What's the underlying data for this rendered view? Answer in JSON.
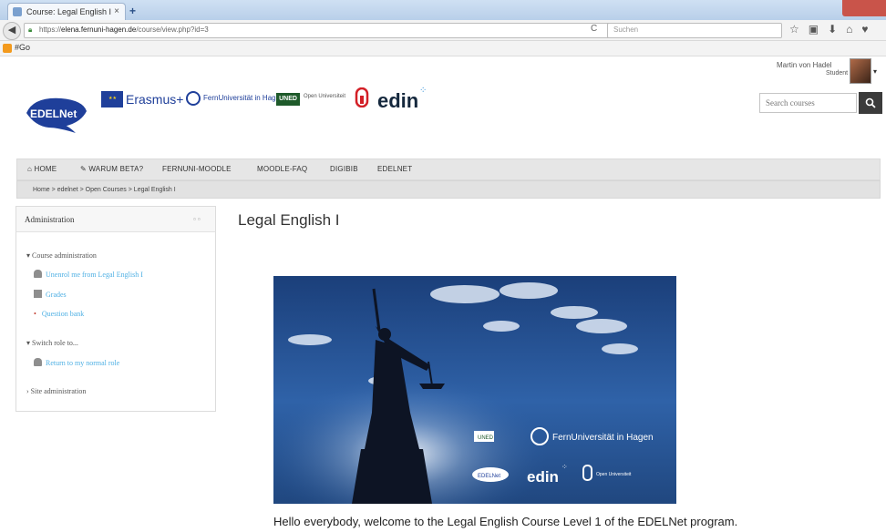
{
  "browser": {
    "tab_title": "Course: Legal English I",
    "url_prefix": "https://",
    "url_host": "elena.fernuni-hagen.de",
    "url_path": "/course/view.php?id=3",
    "search_placeholder": "Suchen",
    "bookmark_label": "Go"
  },
  "user": {
    "name": "Martin von Hadel",
    "role": "Student"
  },
  "logos": {
    "edelnet": "EDELNet",
    "erasmus": "Erasmus+",
    "fernuni": "FernUniversität in Hagen",
    "uned": "UNED",
    "open_univ": "Open Universiteit",
    "edin": "edin"
  },
  "search": {
    "placeholder": "Search courses"
  },
  "nav": {
    "home": "HOME",
    "beta": "WARUM BETA?",
    "fernuni_moodle": "FERNUNI-MOODLE",
    "moodle_faq": "MOODLE-FAQ",
    "digibib": "DIGIBIB",
    "edelnet": "EDELNET"
  },
  "breadcrumb": {
    "home": "Home",
    "sep": ">",
    "edelnet": "edelnet",
    "open_courses": "Open Courses",
    "course": "Legal English I"
  },
  "admin": {
    "title": "Administration",
    "course_admin": "Course administration",
    "unenrol": "Unenrol me from Legal English I",
    "grades": "Grades",
    "question_bank": "Question bank",
    "switch_role": "Switch role to...",
    "return_role": "Return to my normal role",
    "site_admin": "Site administration"
  },
  "course": {
    "title": "Legal English I",
    "welcome": "Hello everybody, welcome to the Legal English Course Level 1 of the EDELNet program.",
    "banner_uned": "UNED",
    "banner_fernuni": "FernUniversität in Hagen",
    "banner_edelnet": "EDELNet",
    "banner_edin": "edin",
    "banner_ou": "Open Universiteit"
  },
  "colors": {
    "link": "#4fb0e4",
    "nav_bg": "#e6e6e6",
    "search_button": "#3b3b3b",
    "edelnet_blue": "#1f3f9a"
  },
  "icons": {
    "home": "home-icon",
    "wrench": "wrench-icon",
    "search": "search-icon",
    "user": "user-icon",
    "grades": "table-icon",
    "question": "bullet-icon"
  }
}
